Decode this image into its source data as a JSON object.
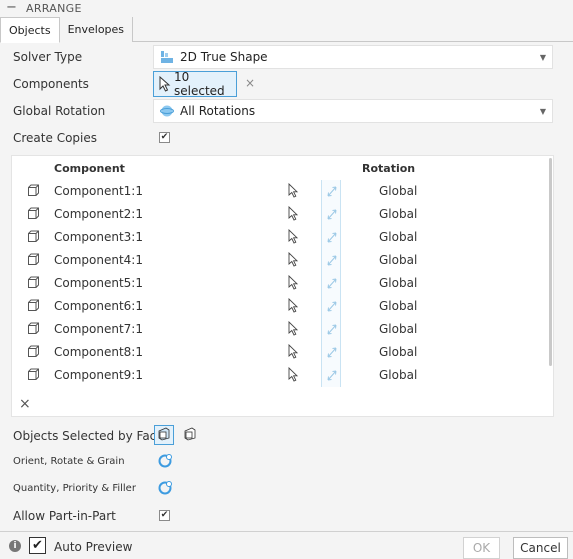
{
  "window": {
    "title": "ARRANGE",
    "collapse_symbol": "−"
  },
  "tabs": [
    {
      "label": "Objects",
      "active": true
    },
    {
      "label": "Envelopes",
      "active": false
    }
  ],
  "solver_type": {
    "label": "Solver Type",
    "value": "2D True Shape",
    "icon": "true-shape-icon"
  },
  "components": {
    "label": "Components",
    "value": "10 selected",
    "clear": "×"
  },
  "global_rotation": {
    "label": "Global Rotation",
    "value": "All Rotations",
    "icon": "rotation-sphere-icon"
  },
  "create_copies": {
    "label": "Create Copies",
    "checked": true,
    "mark": "✔"
  },
  "table": {
    "headers": {
      "component": "Component",
      "rotation": "Rotation"
    },
    "rows": [
      {
        "name": "Component1:1",
        "rotation": "Global"
      },
      {
        "name": "Component2:1",
        "rotation": "Global"
      },
      {
        "name": "Component3:1",
        "rotation": "Global"
      },
      {
        "name": "Component4:1",
        "rotation": "Global"
      },
      {
        "name": "Component5:1",
        "rotation": "Global"
      },
      {
        "name": "Component6:1",
        "rotation": "Global"
      },
      {
        "name": "Component7:1",
        "rotation": "Global"
      },
      {
        "name": "Component8:1",
        "rotation": "Global"
      },
      {
        "name": "Component9:1",
        "rotation": "Global"
      }
    ],
    "delete_symbol": "×"
  },
  "objects_selected_by_face": {
    "label": "Objects Selected by Face"
  },
  "orient_rotate_grain": {
    "label": "Orient, Rotate & Grain"
  },
  "quantity_priority_filler": {
    "label": "Quantity, Priority & Filler"
  },
  "allow_part_in_part": {
    "label": "Allow Part-in-Part",
    "checked": true,
    "mark": "✔"
  },
  "footer": {
    "info_symbol": "i",
    "auto_preview": {
      "label": "Auto Preview",
      "checked": true,
      "mark": "✔"
    },
    "ok_label": "OK",
    "cancel_label": "Cancel"
  },
  "colors": {
    "accent": "#4a9fd8",
    "selected_bg": "#e3f1fb",
    "panel_bg": "#f4f4f4"
  }
}
